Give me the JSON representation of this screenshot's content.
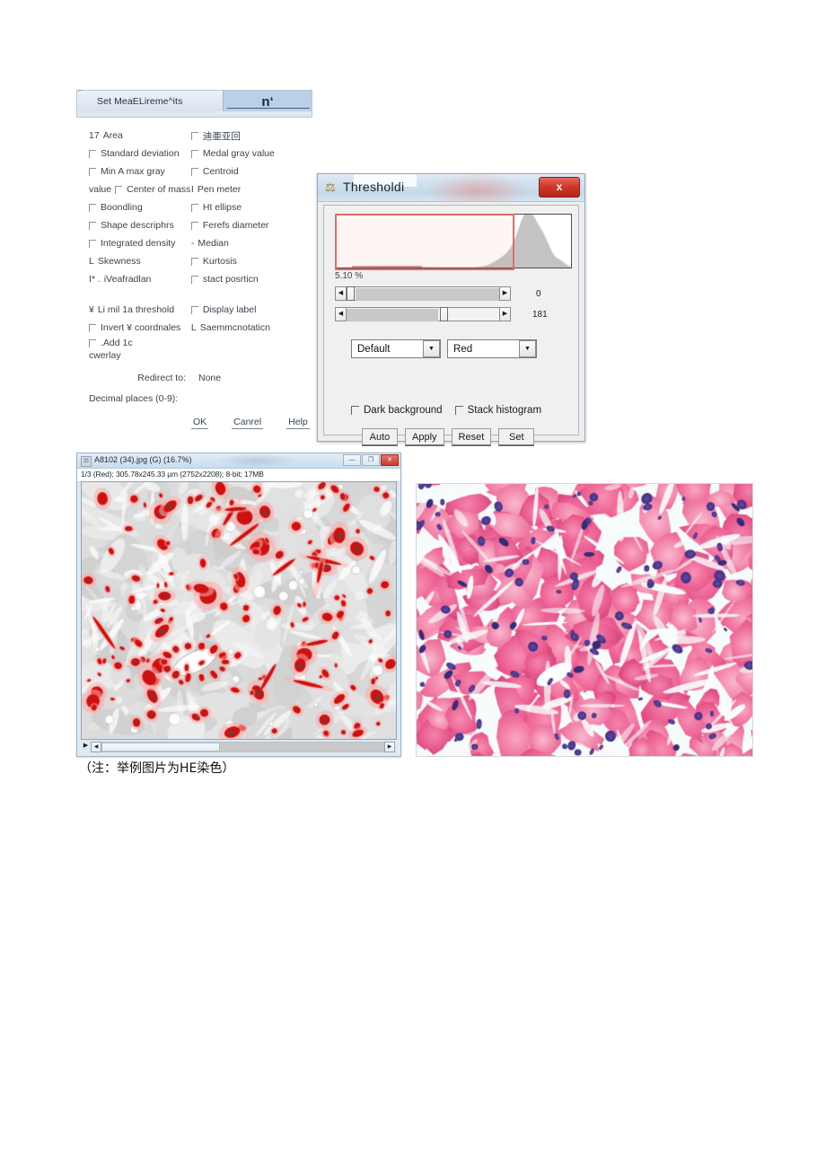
{
  "measurements_window": {
    "title": "Set MeaELireme^its",
    "title_button_glyph": "n‘",
    "left_column": [
      {
        "prefix": "17",
        "label": "Area",
        "checkbox": false
      },
      {
        "prefix": "",
        "label": "Standard deviation",
        "checkbox": true
      },
      {
        "prefix": "",
        "label": "Min A max gray",
        "checkbox": true
      },
      {
        "prefix": "value",
        "label": "Center of mass",
        "checkbox": true
      },
      {
        "prefix": "",
        "label": "Boondling",
        "checkbox": true
      },
      {
        "prefix": "",
        "label": "Shape descriphrs",
        "checkbox": true
      },
      {
        "prefix": "",
        "label": "Integrated density",
        "checkbox": true
      },
      {
        "prefix": "L",
        "label": "Skewness",
        "checkbox": false
      },
      {
        "prefix": "I* .",
        "label": "iVeafradlan",
        "checkbox": false
      }
    ],
    "right_column": [
      {
        "prefix": "",
        "label": "迪亜亚回",
        "checkbox": true,
        "cjk": true
      },
      {
        "prefix": "",
        "label": "Medal gray value",
        "checkbox": true
      },
      {
        "prefix": "",
        "label": "Centroid",
        "checkbox": true
      },
      {
        "prefix": "I",
        "label": "Pen meter",
        "checkbox": false
      },
      {
        "prefix": "",
        "label": "Ht ellipse",
        "checkbox": true
      },
      {
        "prefix": "",
        "label": "Ferefs diameter",
        "checkbox": true
      },
      {
        "prefix": "-",
        "label": "Median",
        "checkbox": false
      },
      {
        "prefix": "",
        "label": "Kurtosis",
        "checkbox": true
      },
      {
        "prefix": "",
        "label": "stact posrticn",
        "checkbox": true
      }
    ],
    "lower_left_column": [
      {
        "prefix": "¥",
        "label": "Li mil 1a threshold",
        "checkbox": false
      },
      {
        "prefix": "",
        "label": "Invert ¥ coordnales",
        "checkbox": true
      },
      {
        "prefix": "",
        "label": ".Add 1c",
        "checkbox": true
      }
    ],
    "lower_left_wrap": "cwerlay",
    "lower_right_column": [
      {
        "prefix": "",
        "label": "Display label",
        "checkbox": true
      },
      {
        "prefix": "L",
        "label": "Saemmcnotaticn",
        "checkbox": false
      }
    ],
    "redirect_label": "Redirect to:",
    "redirect_value": "None",
    "decimal_label": "Decimal places (0-9):",
    "buttons": [
      {
        "label": "OK"
      },
      {
        "label": "Canrel"
      },
      {
        "label": "Help"
      }
    ]
  },
  "threshold_window": {
    "title": "Thresholdi",
    "close_label": "x",
    "histogram_percent": "5.10 %",
    "sliders": [
      {
        "value": "0",
        "thumb_pct": 2,
        "fill_from_pct": 6
      },
      {
        "value": "181",
        "thumb_pct": 60,
        "fill_from_pct": 0
      }
    ],
    "dropdowns": [
      {
        "value": "Default"
      },
      {
        "value": "Red"
      }
    ],
    "checkboxes": [
      {
        "label": "Dark background",
        "checked": false
      },
      {
        "label": "Stack histogram",
        "checked": false
      }
    ],
    "buttons": [
      {
        "label": "Auto"
      },
      {
        "label": "Apply"
      },
      {
        "label": "Reset"
      },
      {
        "label": "Set"
      }
    ],
    "selection_color": "#e26b63"
  },
  "image_window": {
    "title": "A8102 (34).jpg (G) (16.7%)",
    "info_line": "1/3 (Red); 305.78x245.33 µm (2752x2208); 8-bit; 17MB",
    "window_buttons": [
      {
        "name": "minimize",
        "glyph": "—"
      },
      {
        "name": "maximize",
        "glyph": "❐"
      },
      {
        "name": "close",
        "glyph": "✕"
      }
    ],
    "scroll_play_glyph": "▶",
    "scroll_left_glyph": "◀",
    "scroll_right_glyph": "▶"
  },
  "he_image": {
    "alt": "HE stained cardiac muscle micrograph"
  },
  "caption": "（注：举例图片为HE染色）",
  "colors": {
    "threshold_red": "#cc1111",
    "he_pink": "#ef5a92",
    "he_nucleus": "#3a2a7a",
    "accent_blue": "#b9d0e8"
  }
}
